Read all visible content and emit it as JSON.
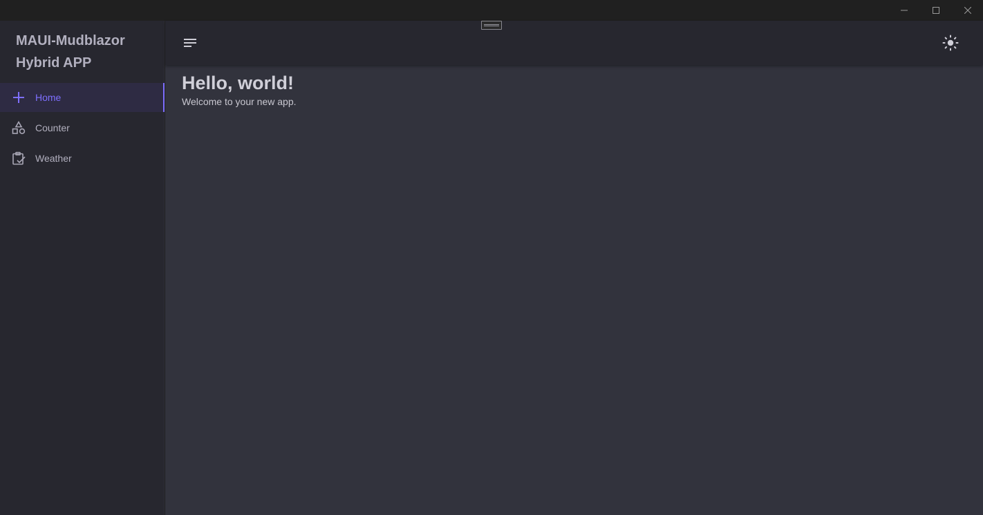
{
  "window": {
    "controls": {
      "minimize_icon": "minimize-icon",
      "maximize_icon": "maximize-icon",
      "close_icon": "close-icon"
    }
  },
  "drawer": {
    "title_line1": "MAUI-Mudblazor",
    "title_line2": "Hybrid APP",
    "items": [
      {
        "label": "Home",
        "icon": "plus-icon",
        "active": true
      },
      {
        "label": "Counter",
        "icon": "shapes-icon",
        "active": false
      },
      {
        "label": "Weather",
        "icon": "clipboard-check-icon",
        "active": false
      }
    ]
  },
  "appbar": {
    "menu_icon": "menu-icon",
    "theme_icon": "sun-icon"
  },
  "content": {
    "title": "Hello, world!",
    "subtitle": "Welcome to your new app."
  },
  "colors": {
    "accent": "#7e6fff",
    "drawer_bg": "#27272f",
    "main_bg": "#32333d",
    "text": "#b2b0bf"
  }
}
